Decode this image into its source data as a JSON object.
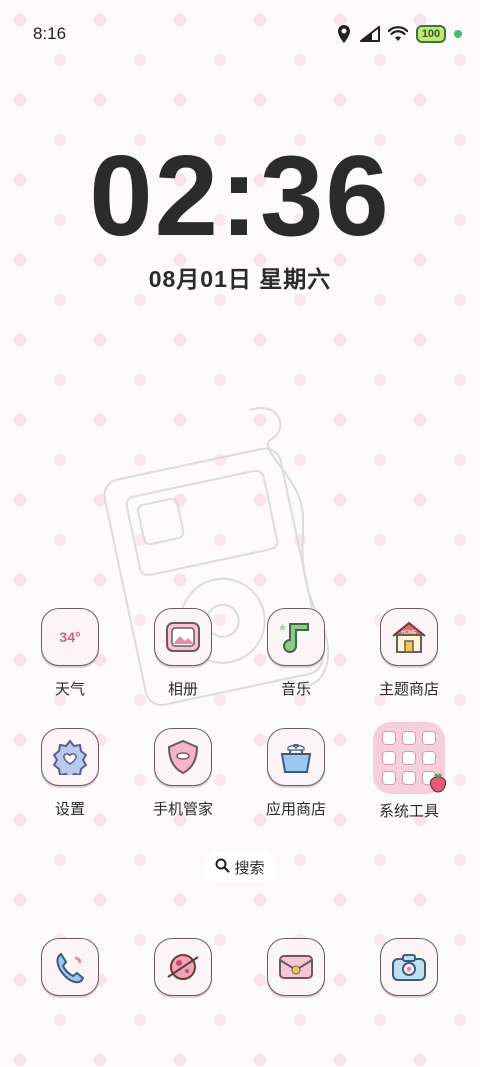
{
  "status_bar": {
    "time": "8:16",
    "battery": "100"
  },
  "clock_widget": {
    "time": "02:36",
    "date": "08月01日 星期六"
  },
  "apps_row1": [
    {
      "label": "天气",
      "icon_text": "34°"
    },
    {
      "label": "相册"
    },
    {
      "label": "音乐"
    },
    {
      "label": "主题商店",
      "icon_text": "HOME"
    }
  ],
  "apps_row2": [
    {
      "label": "设置"
    },
    {
      "label": "手机管家"
    },
    {
      "label": "应用商店"
    },
    {
      "label": "系统工具"
    }
  ],
  "search": {
    "label": "搜索"
  },
  "colors": {
    "accent_pink": "#f5cfdc",
    "icon_outline": "#6b5b61",
    "star_pink": "#f7c8d8"
  }
}
